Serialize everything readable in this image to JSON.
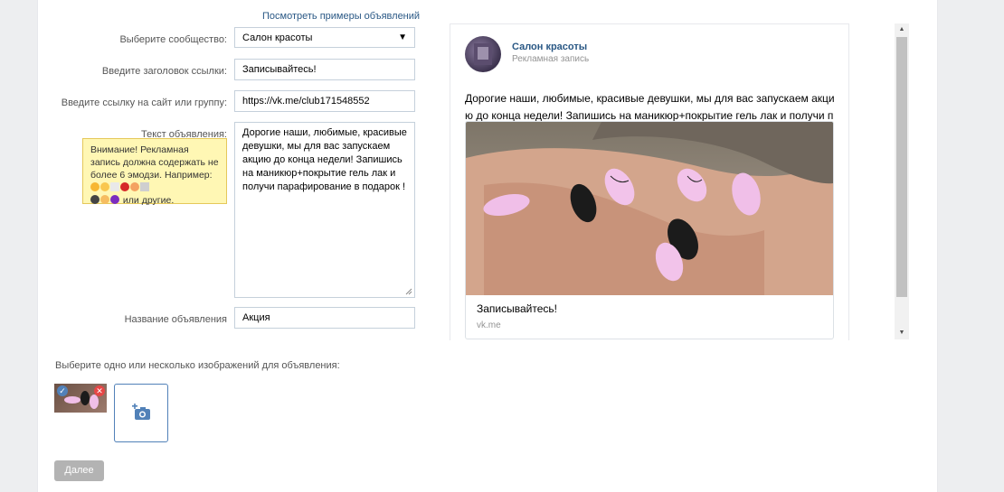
{
  "form": {
    "examples_link": "Посмотреть примеры объявлений",
    "community_label": "Выберите сообщество:",
    "community_value": "Салон красоты",
    "headline_label": "Введите заголовок ссылки:",
    "headline_value": "Записывайтесь!",
    "url_label": "Введите ссылку на сайт или группу:",
    "url_value": "https://vk.me/club171548552",
    "text_label": "Текст объявления:",
    "text_value": "Дорогие наши, любимые, красивые девушки, мы для вас запускаем акцию до конца недели! Запишись на маникюр+покрытие гель лак и получи парафирование в подарок !",
    "warning": {
      "line1": "Внимание! Рекламная запись должна содержать не более 6 эмодзи.",
      "example_prefix": "Например:",
      "example_suffix": "или другие."
    },
    "title_label": "Название объявления",
    "title_value": "Акция"
  },
  "preview": {
    "group_name": "Салон красоты",
    "ad_label": "Рекламная запись",
    "text": "Дорогие наши, любимые, красивые девушки, мы для вас запускаем акцию до конца недели! Запишись на маникюр+покрытие гель лак и получи парафирование в подарок !",
    "card_title": "Записывайтесь!",
    "card_domain": "vk.me"
  },
  "images": {
    "label": "Выберите одно или несколько изображений для объявления:"
  },
  "buttons": {
    "next": "Далее"
  },
  "colors": {
    "link": "#2a5885",
    "accent": "#5181b8",
    "warning_bg": "#fff7b4",
    "disabled_button": "#b3b3b3"
  },
  "icons": [
    "chevron-down-icon",
    "camera-plus-icon",
    "check-icon",
    "close-icon",
    "resize-grip-icon"
  ]
}
